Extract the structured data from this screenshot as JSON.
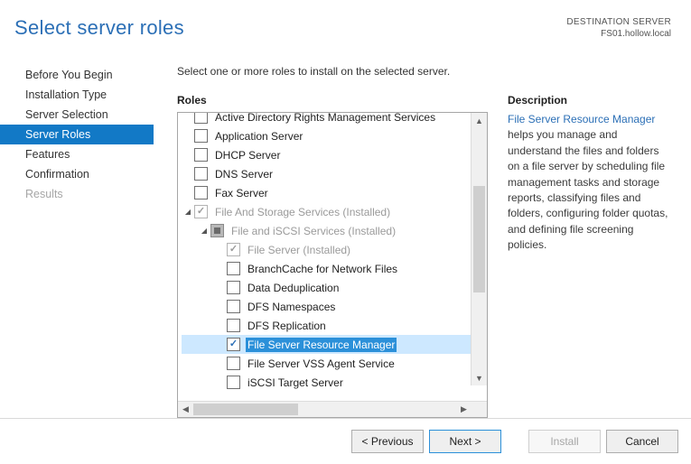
{
  "header": {
    "title": "Select server roles",
    "dest_label": "DESTINATION SERVER",
    "dest_value": "FS01.hollow.local"
  },
  "nav": [
    {
      "label": "Before You Begin",
      "state": "normal"
    },
    {
      "label": "Installation Type",
      "state": "normal"
    },
    {
      "label": "Server Selection",
      "state": "normal"
    },
    {
      "label": "Server Roles",
      "state": "active"
    },
    {
      "label": "Features",
      "state": "normal"
    },
    {
      "label": "Confirmation",
      "state": "normal"
    },
    {
      "label": "Results",
      "state": "disabled"
    }
  ],
  "main": {
    "intro": "Select one or more roles to install on the selected server.",
    "roles_header": "Roles",
    "desc_header": "Description",
    "desc_link": "File Server Resource Manager",
    "desc_text": " helps you manage and understand the files and folders on a file server by scheduling file management tasks and storage reports, classifying files and folders, configuring folder quotas, and defining file screening policies."
  },
  "roles": [
    {
      "indent": 0,
      "tog": "",
      "cb": "unchecked",
      "label": "Active Directory Rights Management Services",
      "cut": true
    },
    {
      "indent": 0,
      "tog": "",
      "cb": "unchecked",
      "label": "Application Server"
    },
    {
      "indent": 0,
      "tog": "",
      "cb": "unchecked",
      "label": "DHCP Server"
    },
    {
      "indent": 0,
      "tog": "",
      "cb": "unchecked",
      "label": "DNS Server"
    },
    {
      "indent": 0,
      "tog": "",
      "cb": "unchecked",
      "label": "Fax Server"
    },
    {
      "indent": 0,
      "tog": "▲",
      "cb": "checked-disabled",
      "label": "File And Storage Services (Installed)",
      "installed": true
    },
    {
      "indent": 1,
      "tog": "▲",
      "cb": "mixed",
      "label": "File and iSCSI Services (Installed)",
      "installed": true
    },
    {
      "indent": 2,
      "tog": "",
      "cb": "checked-disabled",
      "label": "File Server (Installed)",
      "installed": true
    },
    {
      "indent": 2,
      "tog": "",
      "cb": "unchecked",
      "label": "BranchCache for Network Files"
    },
    {
      "indent": 2,
      "tog": "",
      "cb": "unchecked",
      "label": "Data Deduplication"
    },
    {
      "indent": 2,
      "tog": "",
      "cb": "unchecked",
      "label": "DFS Namespaces"
    },
    {
      "indent": 2,
      "tog": "",
      "cb": "unchecked",
      "label": "DFS Replication"
    },
    {
      "indent": 2,
      "tog": "",
      "cb": "checked",
      "label": "File Server Resource Manager",
      "selected": true
    },
    {
      "indent": 2,
      "tog": "",
      "cb": "unchecked",
      "label": "File Server VSS Agent Service"
    },
    {
      "indent": 2,
      "tog": "",
      "cb": "unchecked",
      "label": "iSCSI Target Server"
    }
  ],
  "vscroll": {
    "thumb_top_pct": 24,
    "thumb_height_pct": 44
  },
  "hscroll": {
    "thumb_left_pct": 0,
    "thumb_width_pct": 40
  },
  "buttons": {
    "previous": "< Previous",
    "next": "Next >",
    "install": "Install",
    "cancel": "Cancel"
  }
}
